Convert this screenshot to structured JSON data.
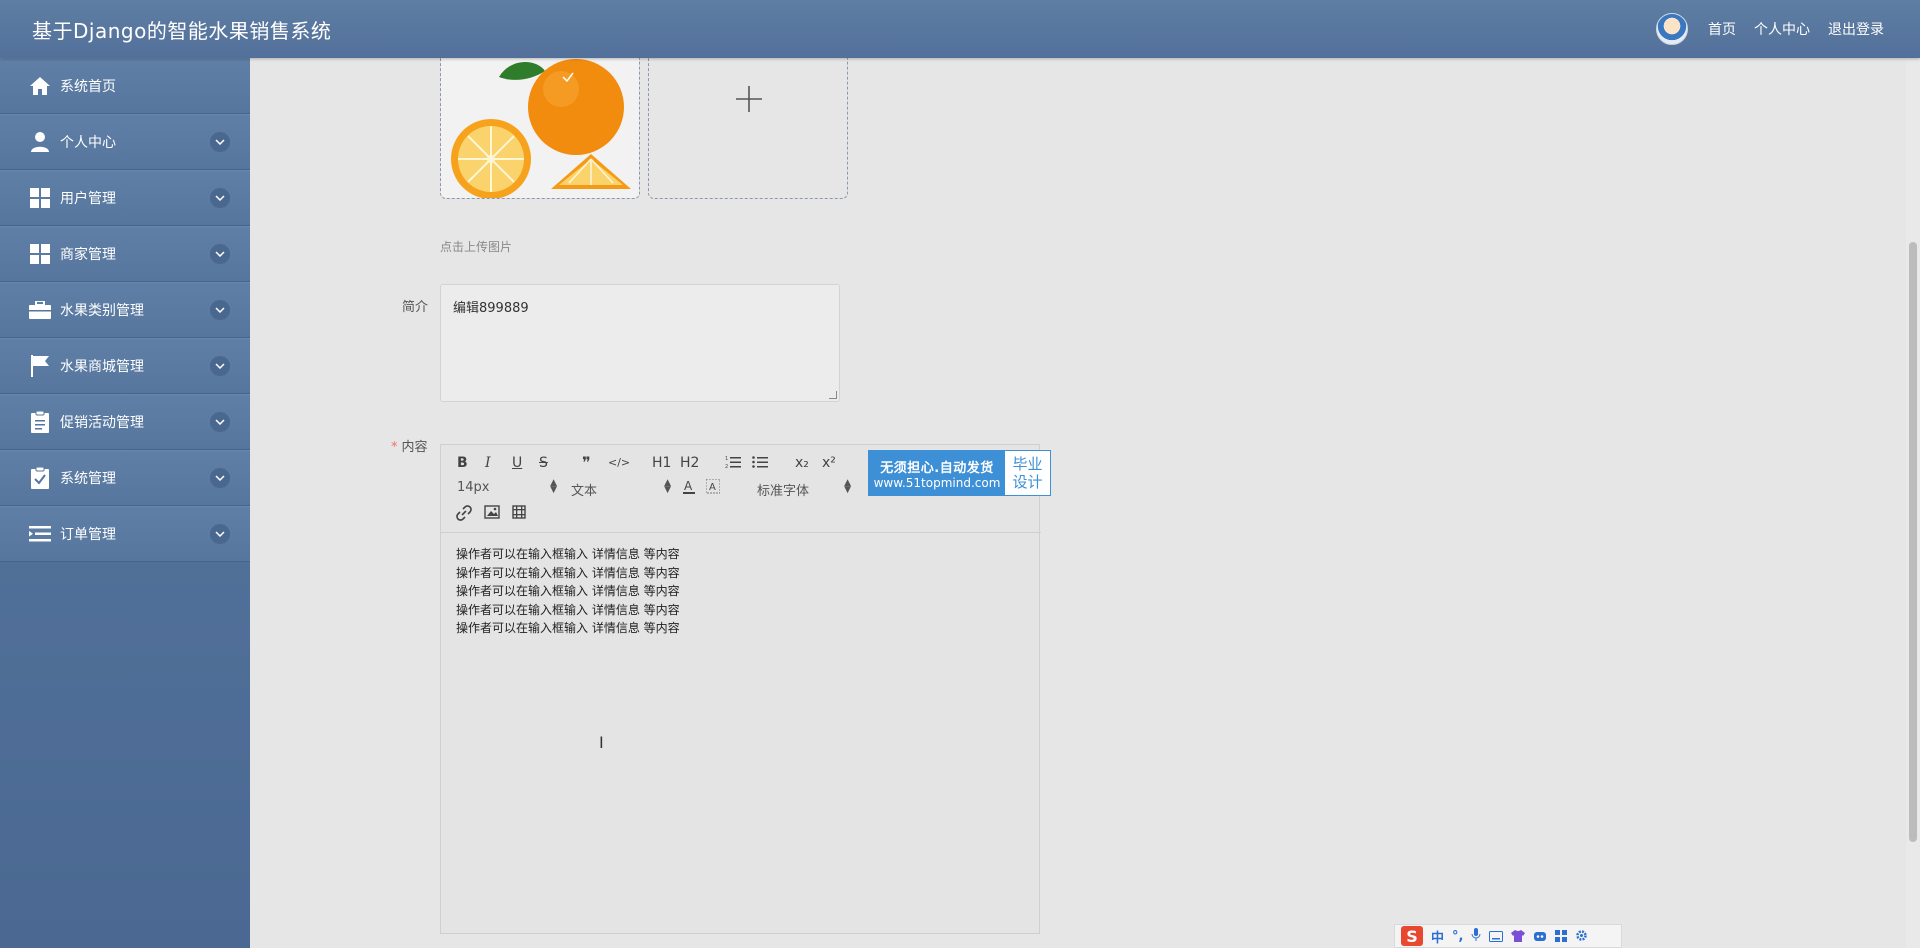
{
  "header": {
    "title": "基于Django的智能水果销售系统",
    "nav": [
      "首页",
      "个人中心",
      "退出登录"
    ]
  },
  "sidebar": {
    "items": [
      {
        "label": "系统首页",
        "icon": "home-icon",
        "has_children": false
      },
      {
        "label": "个人中心",
        "icon": "user-icon",
        "has_children": true
      },
      {
        "label": "用户管理",
        "icon": "grid-icon",
        "has_children": true
      },
      {
        "label": "商家管理",
        "icon": "grid-icon",
        "has_children": true
      },
      {
        "label": "水果类别管理",
        "icon": "briefcase-icon",
        "has_children": true
      },
      {
        "label": "水果商城管理",
        "icon": "flag-icon",
        "has_children": true
      },
      {
        "label": "促销活动管理",
        "icon": "clipboard-icon",
        "has_children": true
      },
      {
        "label": "系统管理",
        "icon": "checklist-icon",
        "has_children": true
      },
      {
        "label": "订单管理",
        "icon": "list-icon",
        "has_children": true
      }
    ]
  },
  "form": {
    "upload_tip": "点击上传图片",
    "intro_label": "简介",
    "intro_value": "编辑899889",
    "content_label": "内容",
    "content_required": "*"
  },
  "editor": {
    "toolbar": {
      "bold": "B",
      "italic": "I",
      "underline": "U",
      "strike": "S",
      "quote": "❞",
      "code": "</>",
      "h1": "H1",
      "h2": "H2",
      "sub": "x₂",
      "sup": "x²",
      "font_size": "14px",
      "format": "文本",
      "font_family": "标准字体"
    },
    "lines": [
      "操作者可以在输入框输入  详情信息  等内容",
      "操作者可以在输入框输入  详情信息  等内容",
      "操作者可以在输入框输入  详情信息  等内容",
      "操作者可以在输入框输入  详情信息  等内容",
      "操作者可以在输入框输入  详情信息  等内容"
    ]
  },
  "watermark": {
    "line1": "无须担心.自动发货",
    "line2": "www.51topmind.com",
    "right1": "毕业",
    "right2": "设计"
  },
  "ime": {
    "mode": "中",
    "punct": "°,"
  },
  "colors": {
    "header": "#5a789f",
    "sidebar": "#52709a",
    "accent": "#3d8fd6",
    "required": "#f56c6c"
  }
}
